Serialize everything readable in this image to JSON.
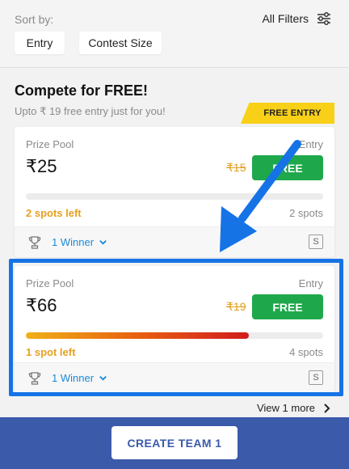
{
  "sort": {
    "label": "Sort by:",
    "options": [
      "Entry",
      "Contest Size"
    ],
    "filters_label": "All Filters"
  },
  "section": {
    "title": "Compete for FREE!",
    "subtitle": "Upto ₹ 19 free entry just for you!",
    "banner": "FREE ENTRY"
  },
  "contests": [
    {
      "prize_label": "Prize Pool",
      "entry_label": "Entry",
      "prize": "₹25",
      "original_entry": "₹15",
      "entry_button": "FREE",
      "fill_fraction": 0.0,
      "spots_left": "2 spots left",
      "total_spots": "2 spots",
      "winners": "1 Winner",
      "badge": "S"
    },
    {
      "prize_label": "Prize Pool",
      "entry_label": "Entry",
      "prize": "₹66",
      "original_entry": "₹19",
      "entry_button": "FREE",
      "fill_fraction": 0.75,
      "spots_left": "1 spot left",
      "total_spots": "4 spots",
      "winners": "1 Winner",
      "badge": "S"
    }
  ],
  "view_more": "View 1 more",
  "create_button": "CREATE TEAM 1",
  "colors": {
    "accent_blue": "#3b5baa",
    "free_green": "#1ea84b",
    "banner_yellow": "#f8d018",
    "spots_orange": "#e8a020",
    "highlight_blue": "#1673e6"
  },
  "icons": [
    "filter-sliders-icon",
    "trophy-icon",
    "chevron-down-icon",
    "chevron-right-icon",
    "pointer-arrow-icon"
  ]
}
